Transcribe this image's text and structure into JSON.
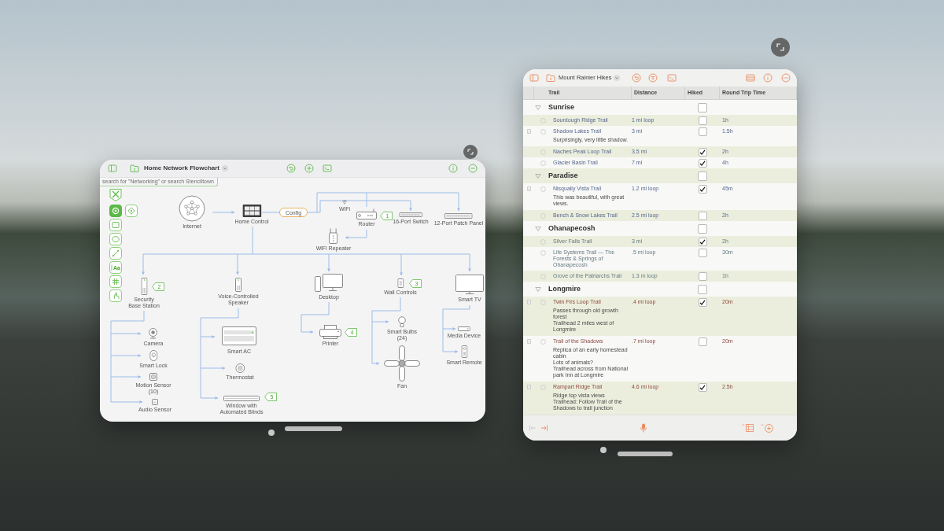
{
  "flowchart_window": {
    "title": "Home Network Flowchart",
    "note": "search for \"Networking\" or search Stenciltown",
    "tools": [
      {
        "kind": "select",
        "selected": true
      },
      {
        "kind": "diamond",
        "selected": false
      },
      {
        "kind": "rectangle",
        "selected": false
      },
      {
        "kind": "ellipse",
        "selected": false
      },
      {
        "kind": "line",
        "selected": false
      },
      {
        "kind": "text",
        "label": "Aa",
        "selected": false
      },
      {
        "kind": "grid",
        "selected": false
      },
      {
        "kind": "hand",
        "selected": false
      }
    ],
    "nodes": [
      {
        "kind": "network",
        "label": "Internet"
      },
      {
        "kind": "hub",
        "label": "Home Control"
      },
      {
        "kind": "pill",
        "label": "Config"
      },
      {
        "kind": "wifi",
        "label": "WiFi"
      },
      {
        "kind": "router",
        "label": "Router",
        "tag": "1"
      },
      {
        "kind": "switch",
        "label": "16-Port Switch"
      },
      {
        "kind": "patch-panel",
        "label": "12-Port Patch Panel"
      },
      {
        "kind": "repeater",
        "label": "WiFi Repeater"
      },
      {
        "kind": "tower",
        "label": "Security Base Station",
        "tag": "2"
      },
      {
        "kind": "speaker",
        "label": "Voice-Controlled Speaker"
      },
      {
        "kind": "desktop",
        "label": "Desktop"
      },
      {
        "kind": "wall-control",
        "label": "Wall Controls",
        "tag": "3"
      },
      {
        "kind": "tv",
        "label": "Smart TV"
      },
      {
        "kind": "camera",
        "label": "Camera"
      },
      {
        "kind": "lock",
        "label": "Smart Lock"
      },
      {
        "kind": "sensor",
        "label": "Motion Sensor (10)"
      },
      {
        "kind": "audio-sensor",
        "label": "Audio Sensor"
      },
      {
        "kind": "ac",
        "label": "Smart AC"
      },
      {
        "kind": "thermostat",
        "label": "Thermostat"
      },
      {
        "kind": "blinds",
        "label": "Window with Automated Blinds",
        "tag": "5"
      },
      {
        "kind": "printer",
        "label": "Printer",
        "tag": "4"
      },
      {
        "kind": "bulb",
        "label": "Smart Bulbs (24)"
      },
      {
        "kind": "fan",
        "label": "Fan"
      },
      {
        "kind": "media",
        "label": "Media Device"
      },
      {
        "kind": "remote",
        "label": "Smart Remote"
      }
    ]
  },
  "outline_window": {
    "title": "Mount Rainier Hikes",
    "columns": [
      "Trail",
      "Distance",
      "Hiked",
      "Round Trip Time"
    ],
    "sections": [
      {
        "title": "Sunrise",
        "expanded": true,
        "hiked": false,
        "children": [
          {
            "trail": "Sourdough Ridge Trail",
            "distance": "1 mi loop",
            "hiked": false,
            "time": "1h"
          },
          {
            "trail": "Shadow Lakes Trail",
            "distance": "3 mi",
            "hiked": false,
            "time": "1.5h",
            "note": [
              "Surprisingly, very little shadow."
            ]
          },
          {
            "trail": "Naches Peak Loop Trail",
            "distance": "3.5 mi",
            "hiked": true,
            "time": "2h"
          },
          {
            "trail": "Glacier Basin Trail",
            "distance": "7 mi",
            "hiked": true,
            "time": "4h"
          }
        ]
      },
      {
        "title": "Paradise",
        "expanded": true,
        "hiked": false,
        "children": [
          {
            "trail": "Nisqually Vista Trail",
            "distance": "1.2 mi loop",
            "hiked": true,
            "time": "45m",
            "note": [
              "This was beautiful, with great views."
            ]
          },
          {
            "trail": "Bench & Snow Lakes Trail",
            "distance": "2.5 mi loop",
            "hiked": false,
            "time": "2h"
          }
        ]
      },
      {
        "title": "Ohanapecosh",
        "expanded": true,
        "hiked": false,
        "children": [
          {
            "trail": "Silver Falls Trail",
            "distance": "3 mi",
            "hiked": true,
            "time": "2h"
          },
          {
            "trail": "Life Systems Trail — The Forests & Springs of Ohanapecosh",
            "distance": ".5 mi loop",
            "hiked": false,
            "time": "30m"
          },
          {
            "trail": "Grove of the Patriarchs Trail",
            "distance": "1.3 m loop",
            "hiked": false,
            "time": "1h"
          }
        ]
      },
      {
        "title": "Longmire",
        "expanded": true,
        "hiked": false,
        "children": [
          {
            "trail": "Twin Firs Loop Trail",
            "distance": ".4 mi loop",
            "hiked": true,
            "time": "20m",
            "note": [
              "Passes through old growth forest",
              "Trailhead 2 miles west of Longmire"
            ]
          },
          {
            "trail": "Trail of the Shadows",
            "distance": ".7 mi loop",
            "hiked": false,
            "time": "20m",
            "note": [
              "Replica of an early homestead cabin",
              "Lots of animals?",
              "Trailhead across from National park Inn at Longmire"
            ]
          },
          {
            "trail": "Rampart Ridge Trail",
            "distance": "4.6 mi loop",
            "hiked": true,
            "time": "2.5h",
            "note": [
              "Ridge top vista views",
              "Trailhead: Follow Trail of the Shadows to trail junction"
            ]
          }
        ]
      }
    ],
    "bottom_tools": [
      {
        "kind": "outdent",
        "disabled": true
      },
      {
        "kind": "indent",
        "disabled": false
      }
    ]
  }
}
